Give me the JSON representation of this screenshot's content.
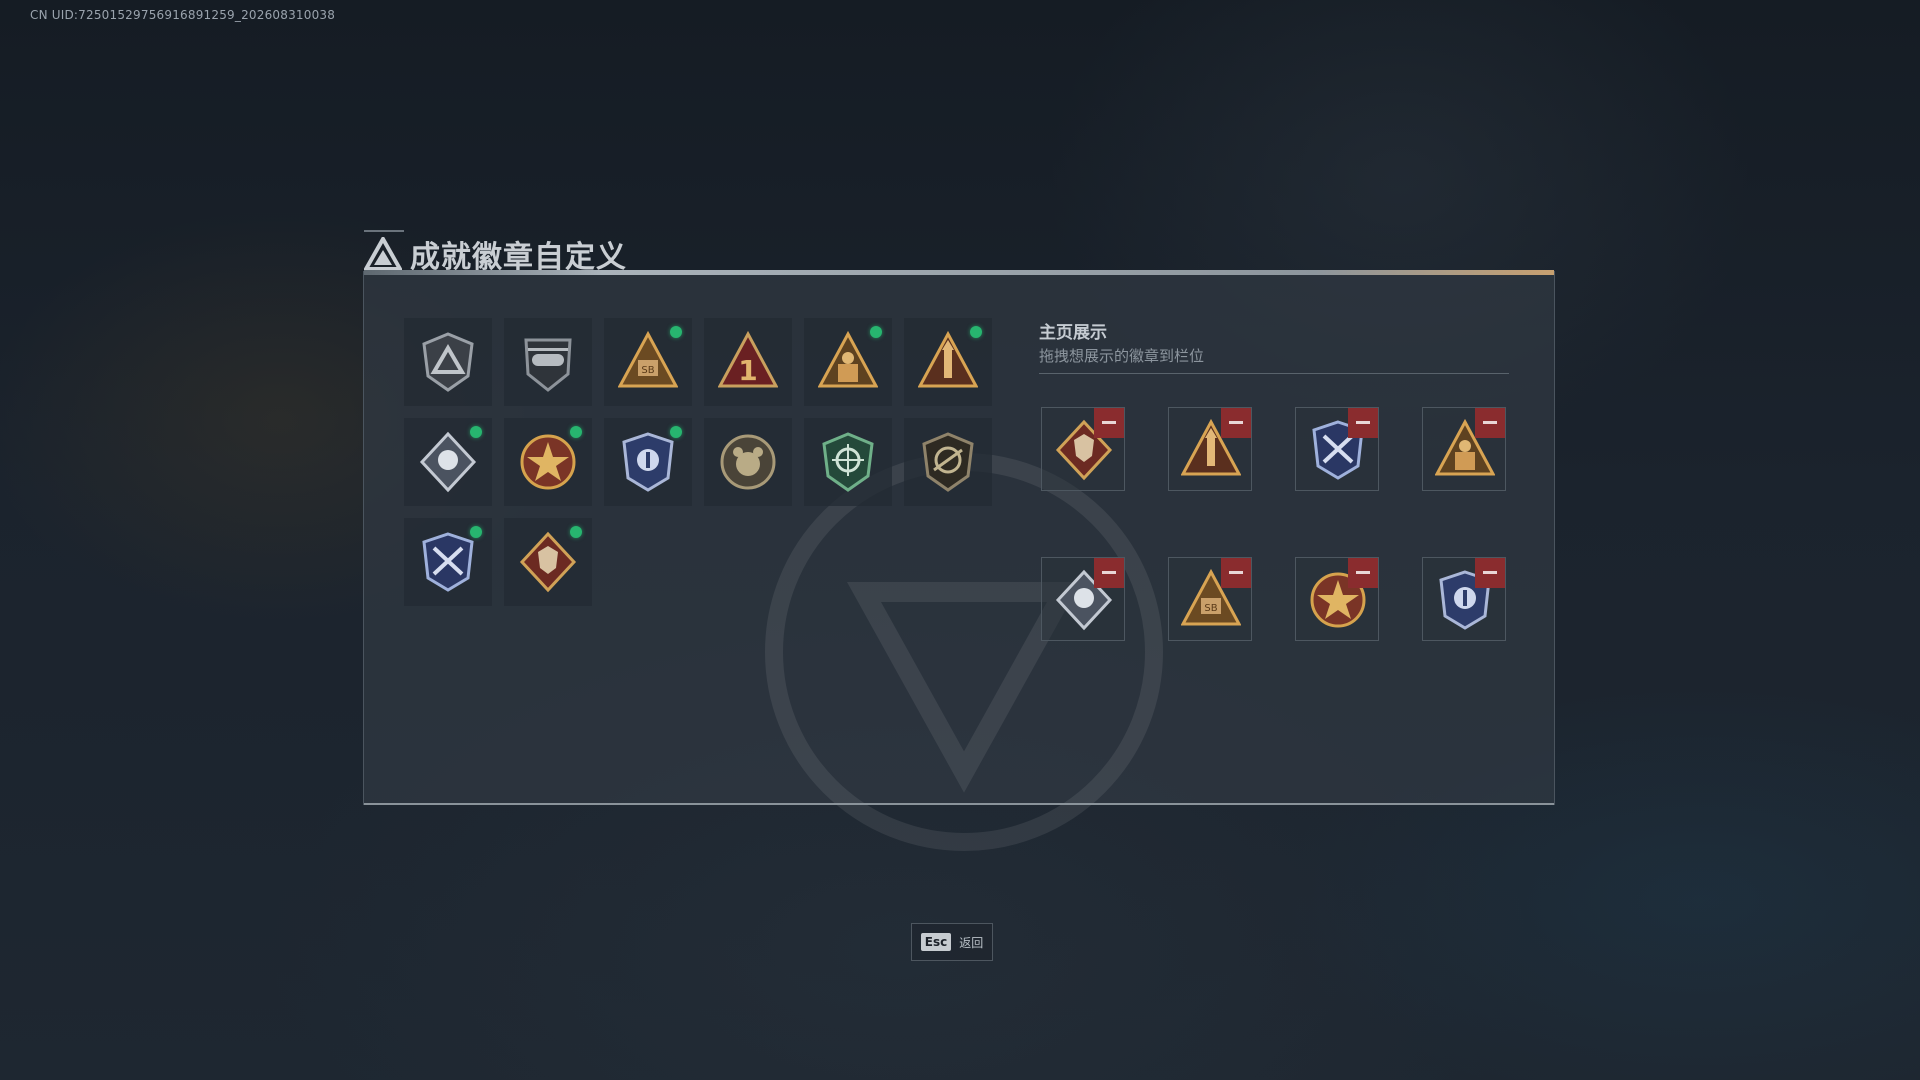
{
  "uid_text": "CN UID:7250152975691689125​9_202608310038",
  "header": {
    "title": "成就徽章自定义"
  },
  "collection": {
    "badges": [
      {
        "name": "shield-emblem-badge",
        "icon": "badge-grey-shield",
        "new": false
      },
      {
        "name": "helicopter-badge",
        "icon": "badge-grey-heli",
        "new": false
      },
      {
        "name": "sb-triangle-badge",
        "icon": "badge-gold-sb",
        "new": true
      },
      {
        "name": "number-one-badge",
        "icon": "badge-red-one",
        "new": false
      },
      {
        "name": "soldier-triangle-badge",
        "icon": "badge-gold-soldier",
        "new": true
      },
      {
        "name": "rocket-triangle-badge",
        "icon": "badge-gold-rocket",
        "new": true
      },
      {
        "name": "eagle-diamond-badge",
        "icon": "badge-silver-eagle",
        "new": true
      },
      {
        "name": "star-medal-badge",
        "icon": "badge-red-star",
        "new": true
      },
      {
        "name": "blue-shield-badge",
        "icon": "badge-blue-police",
        "new": true
      },
      {
        "name": "bear-round-badge",
        "icon": "badge-grey-bear",
        "new": false
      },
      {
        "name": "crosshair-shield-badge",
        "icon": "badge-green-target",
        "new": false
      },
      {
        "name": "plane-round-badge",
        "icon": "badge-dark-plane",
        "new": false
      },
      {
        "name": "crossed-arrows-badge",
        "icon": "badge-blue-arrows",
        "new": true
      },
      {
        "name": "wolf-diamond-badge",
        "icon": "badge-red-wolf",
        "new": true
      }
    ]
  },
  "showcase": {
    "title": "主页展示",
    "subtitle": "拖拽想展示的徽章到栏位",
    "slots": [
      {
        "name": "slot-wolf",
        "icon": "badge-red-wolf"
      },
      {
        "name": "slot-rocket",
        "icon": "badge-gold-rocket"
      },
      {
        "name": "slot-arrows",
        "icon": "badge-blue-arrows"
      },
      {
        "name": "slot-soldier",
        "icon": "badge-gold-soldier"
      },
      {
        "name": "slot-eagle",
        "icon": "badge-silver-eagle"
      },
      {
        "name": "slot-sb",
        "icon": "badge-gold-sb"
      },
      {
        "name": "slot-star",
        "icon": "badge-red-star"
      },
      {
        "name": "slot-police",
        "icon": "badge-blue-police"
      }
    ]
  },
  "footer": {
    "esc_key": "Esc",
    "back_label": "返回"
  },
  "colors": {
    "new_dot": "#27b56f",
    "remove": "#8a2c2e",
    "panel": "#30394a"
  }
}
